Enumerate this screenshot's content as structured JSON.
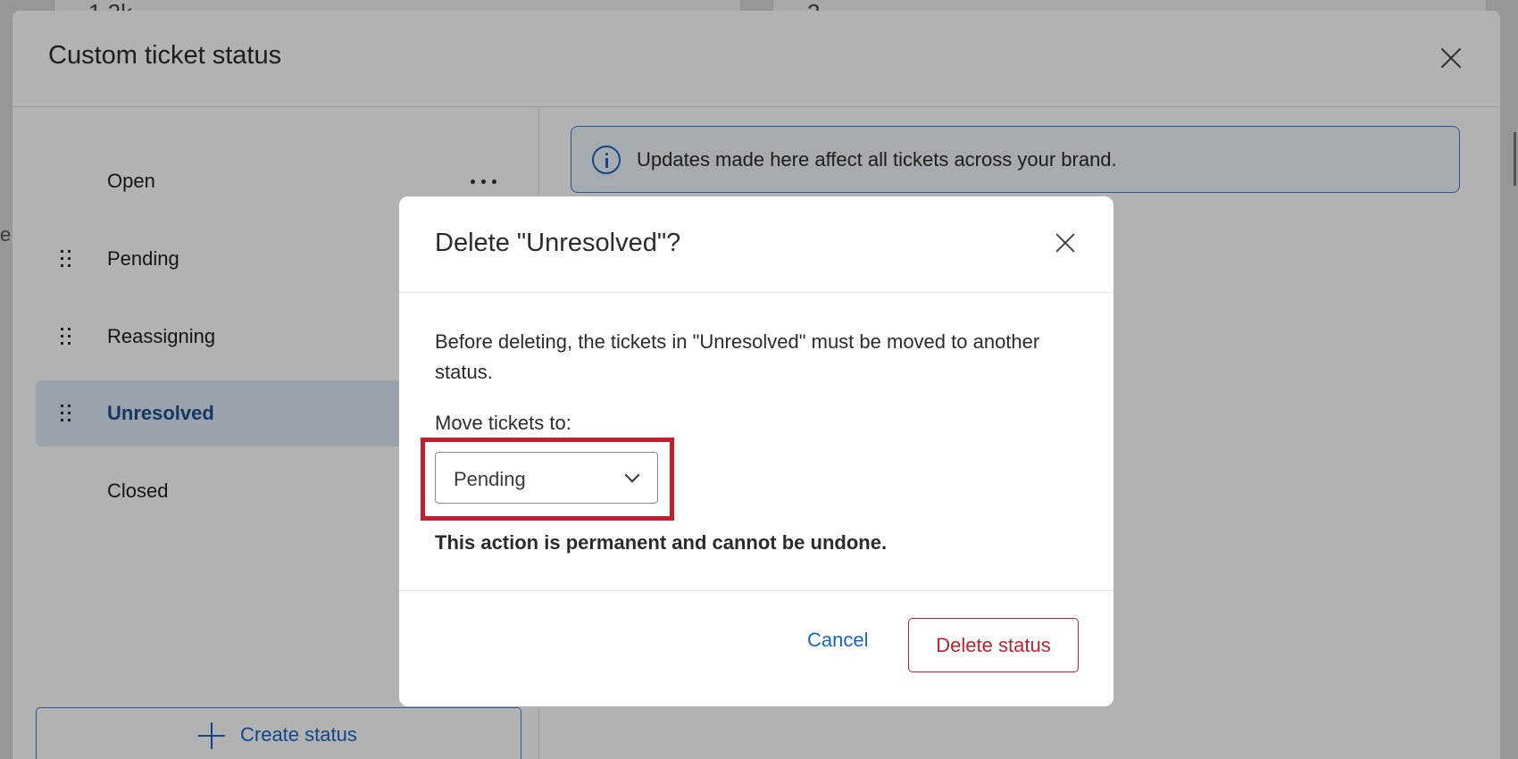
{
  "background": {
    "card_values": [
      "1.2k",
      "2"
    ],
    "edge_text": "e"
  },
  "main_modal": {
    "title": "Custom ticket status",
    "statuses": [
      {
        "label": "Open",
        "draggable": false,
        "active": false
      },
      {
        "label": "Pending",
        "draggable": true,
        "active": false
      },
      {
        "label": "Reassigning",
        "draggable": true,
        "active": false
      },
      {
        "label": "Unresolved",
        "draggable": true,
        "active": true
      },
      {
        "label": "Closed",
        "draggable": false,
        "active": false
      }
    ],
    "create_button_label": "Create status",
    "info_banner_text": "Updates made here affect all tickets across your brand."
  },
  "dialog": {
    "title": "Delete \"Unresolved\"?",
    "description": "Before deleting, the tickets in \"Unresolved\" must be moved to another status.",
    "move_label": "Move tickets to:",
    "selected_option": "Pending",
    "warning": "This action is permanent and cannot be undone.",
    "cancel_label": "Cancel",
    "delete_label": "Delete status"
  },
  "colors": {
    "accent_blue": "#1a64c7",
    "danger_red": "#c41e2e",
    "active_item_bg": "#dde9f7"
  },
  "icons": [
    "close-icon",
    "more-icon",
    "drag-handle-icon",
    "plus-icon",
    "info-icon",
    "chevron-down-icon"
  ]
}
